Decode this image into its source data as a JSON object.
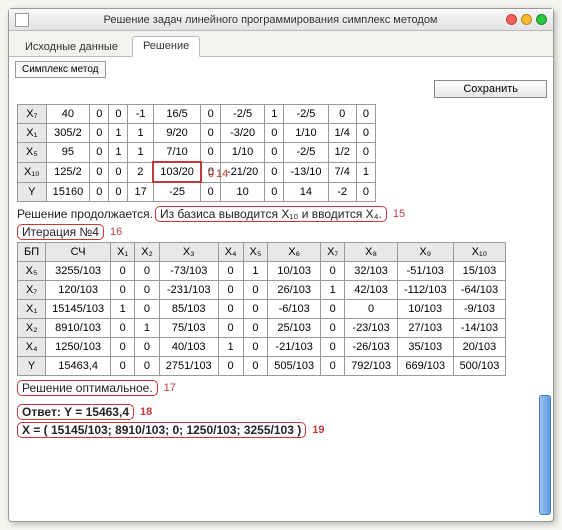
{
  "window": {
    "title": "Решение задач линейного программирования симплекс методом"
  },
  "tabs": {
    "tab1": "Исходные данные",
    "tab2": "Решение"
  },
  "subbar": {
    "method_btn": "Симплекс метод",
    "save_btn": "Сохранить"
  },
  "table1": {
    "rows": [
      {
        "bp": "X₇",
        "c": [
          "40",
          "0",
          "0",
          "-1",
          "16/5",
          "0",
          "-2/5",
          "1",
          "-2/5",
          "0",
          "0"
        ]
      },
      {
        "bp": "X₁",
        "c": [
          "305/2",
          "0",
          "1",
          "1",
          "9/20",
          "0",
          "-3/20",
          "0",
          "1/10",
          "1/4",
          "0"
        ]
      },
      {
        "bp": "X₅",
        "c": [
          "95",
          "0",
          "1",
          "1",
          "7/10",
          "0",
          "1/10",
          "0",
          "-2/5",
          "1/2",
          "0"
        ]
      },
      {
        "bp": "X₁₀",
        "c": [
          "125/2",
          "0",
          "0",
          "2",
          "103/20",
          "0",
          "-21/20",
          "0",
          "-13/10",
          "7/4",
          "1"
        ]
      },
      {
        "bp": "Y",
        "c": [
          "15160",
          "0",
          "0",
          "17",
          "-25",
          "0",
          "10",
          "0",
          "14",
          "-2",
          "0"
        ]
      }
    ],
    "pivot_note": "0"
  },
  "lines": {
    "cont_prefix": "Решение продолжается.",
    "basis_swap": "Из базиса выводится X₁₀ и вводится X₄.",
    "iter_label": "Итерация №4"
  },
  "annot": {
    "n14": "14",
    "n15": "15",
    "n16": "16",
    "n17": "17",
    "n18": "18",
    "n19": "19"
  },
  "table2": {
    "headers": [
      "БП",
      "СЧ",
      "X₁",
      "X₂",
      "X₃",
      "X₄",
      "X₅",
      "X₆",
      "X₇",
      "X₈",
      "X₉",
      "X₁₀"
    ],
    "rows": [
      {
        "bp": "X₅",
        "c": [
          "3255/103",
          "0",
          "0",
          "-73/103",
          "0",
          "1",
          "10/103",
          "0",
          "32/103",
          "-51/103",
          "15/103"
        ]
      },
      {
        "bp": "X₇",
        "c": [
          "120/103",
          "0",
          "0",
          "-231/103",
          "0",
          "0",
          "26/103",
          "1",
          "42/103",
          "-112/103",
          "-64/103"
        ]
      },
      {
        "bp": "X₁",
        "c": [
          "15145/103",
          "1",
          "0",
          "85/103",
          "0",
          "0",
          "-6/103",
          "0",
          "0",
          "10/103",
          "-9/103"
        ]
      },
      {
        "bp": "X₂",
        "c": [
          "8910/103",
          "0",
          "1",
          "75/103",
          "0",
          "0",
          "25/103",
          "0",
          "-23/103",
          "27/103",
          "-14/103"
        ]
      },
      {
        "bp": "X₄",
        "c": [
          "1250/103",
          "0",
          "0",
          "40/103",
          "1",
          "0",
          "-21/103",
          "0",
          "-26/103",
          "35/103",
          "20/103"
        ]
      },
      {
        "bp": "Y",
        "c": [
          "15463,4",
          "0",
          "0",
          "2751/103",
          "0",
          "0",
          "505/103",
          "0",
          "792/103",
          "669/103",
          "500/103"
        ]
      }
    ]
  },
  "result": {
    "optimal": "Решение оптимальное.",
    "answer_y": "Ответ: Y = 15463,4",
    "answer_x": "X = ( 15145/103; 8910/103; 0; 1250/103; 3255/103 )"
  }
}
